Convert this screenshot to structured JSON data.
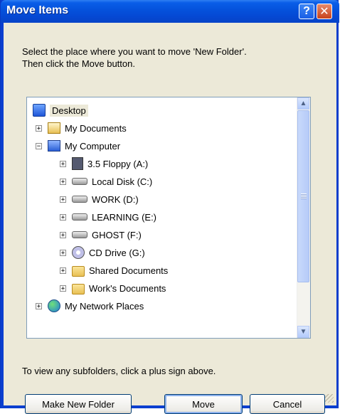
{
  "window": {
    "title": "Move Items",
    "help_glyph": "?",
    "close_glyph": "✕"
  },
  "instructions": {
    "line1": "Select the place where you want to move 'New Folder'.",
    "line2": "Then click the Move button."
  },
  "tree": {
    "items": [
      {
        "label": "Desktop",
        "icon": "desktop-icon",
        "expander": ""
      },
      {
        "label": "My Documents",
        "icon": "my-documents-icon",
        "expander": "+"
      },
      {
        "label": "My Computer",
        "icon": "my-computer-icon",
        "expander": "−"
      },
      {
        "label": "3.5 Floppy (A:)",
        "icon": "floppy-drive-icon",
        "expander": "+"
      },
      {
        "label": "Local Disk (C:)",
        "icon": "hard-drive-icon",
        "expander": "+"
      },
      {
        "label": "WORK (D:)",
        "icon": "hard-drive-icon",
        "expander": "+"
      },
      {
        "label": "LEARNING (E:)",
        "icon": "hard-drive-icon",
        "expander": "+"
      },
      {
        "label": "GHOST (F:)",
        "icon": "hard-drive-icon",
        "expander": "+"
      },
      {
        "label": "CD Drive (G:)",
        "icon": "cd-drive-icon",
        "expander": "+"
      },
      {
        "label": "Shared Documents",
        "icon": "folder-icon",
        "expander": "+"
      },
      {
        "label": "Work's Documents",
        "icon": "folder-icon",
        "expander": "+"
      },
      {
        "label": "My Network Places",
        "icon": "network-places-icon",
        "expander": "+"
      }
    ],
    "scroll_up_glyph": "▲",
    "scroll_down_glyph": "▼"
  },
  "hint": "To view any subfolders, click a plus sign above.",
  "buttons": {
    "make_new_folder": "Make New Folder",
    "move": "Move",
    "cancel": "Cancel"
  },
  "colors": {
    "titlebar": "#0553dd",
    "dialog_bg": "#ece9d8",
    "tree_border": "#7f9db9"
  }
}
